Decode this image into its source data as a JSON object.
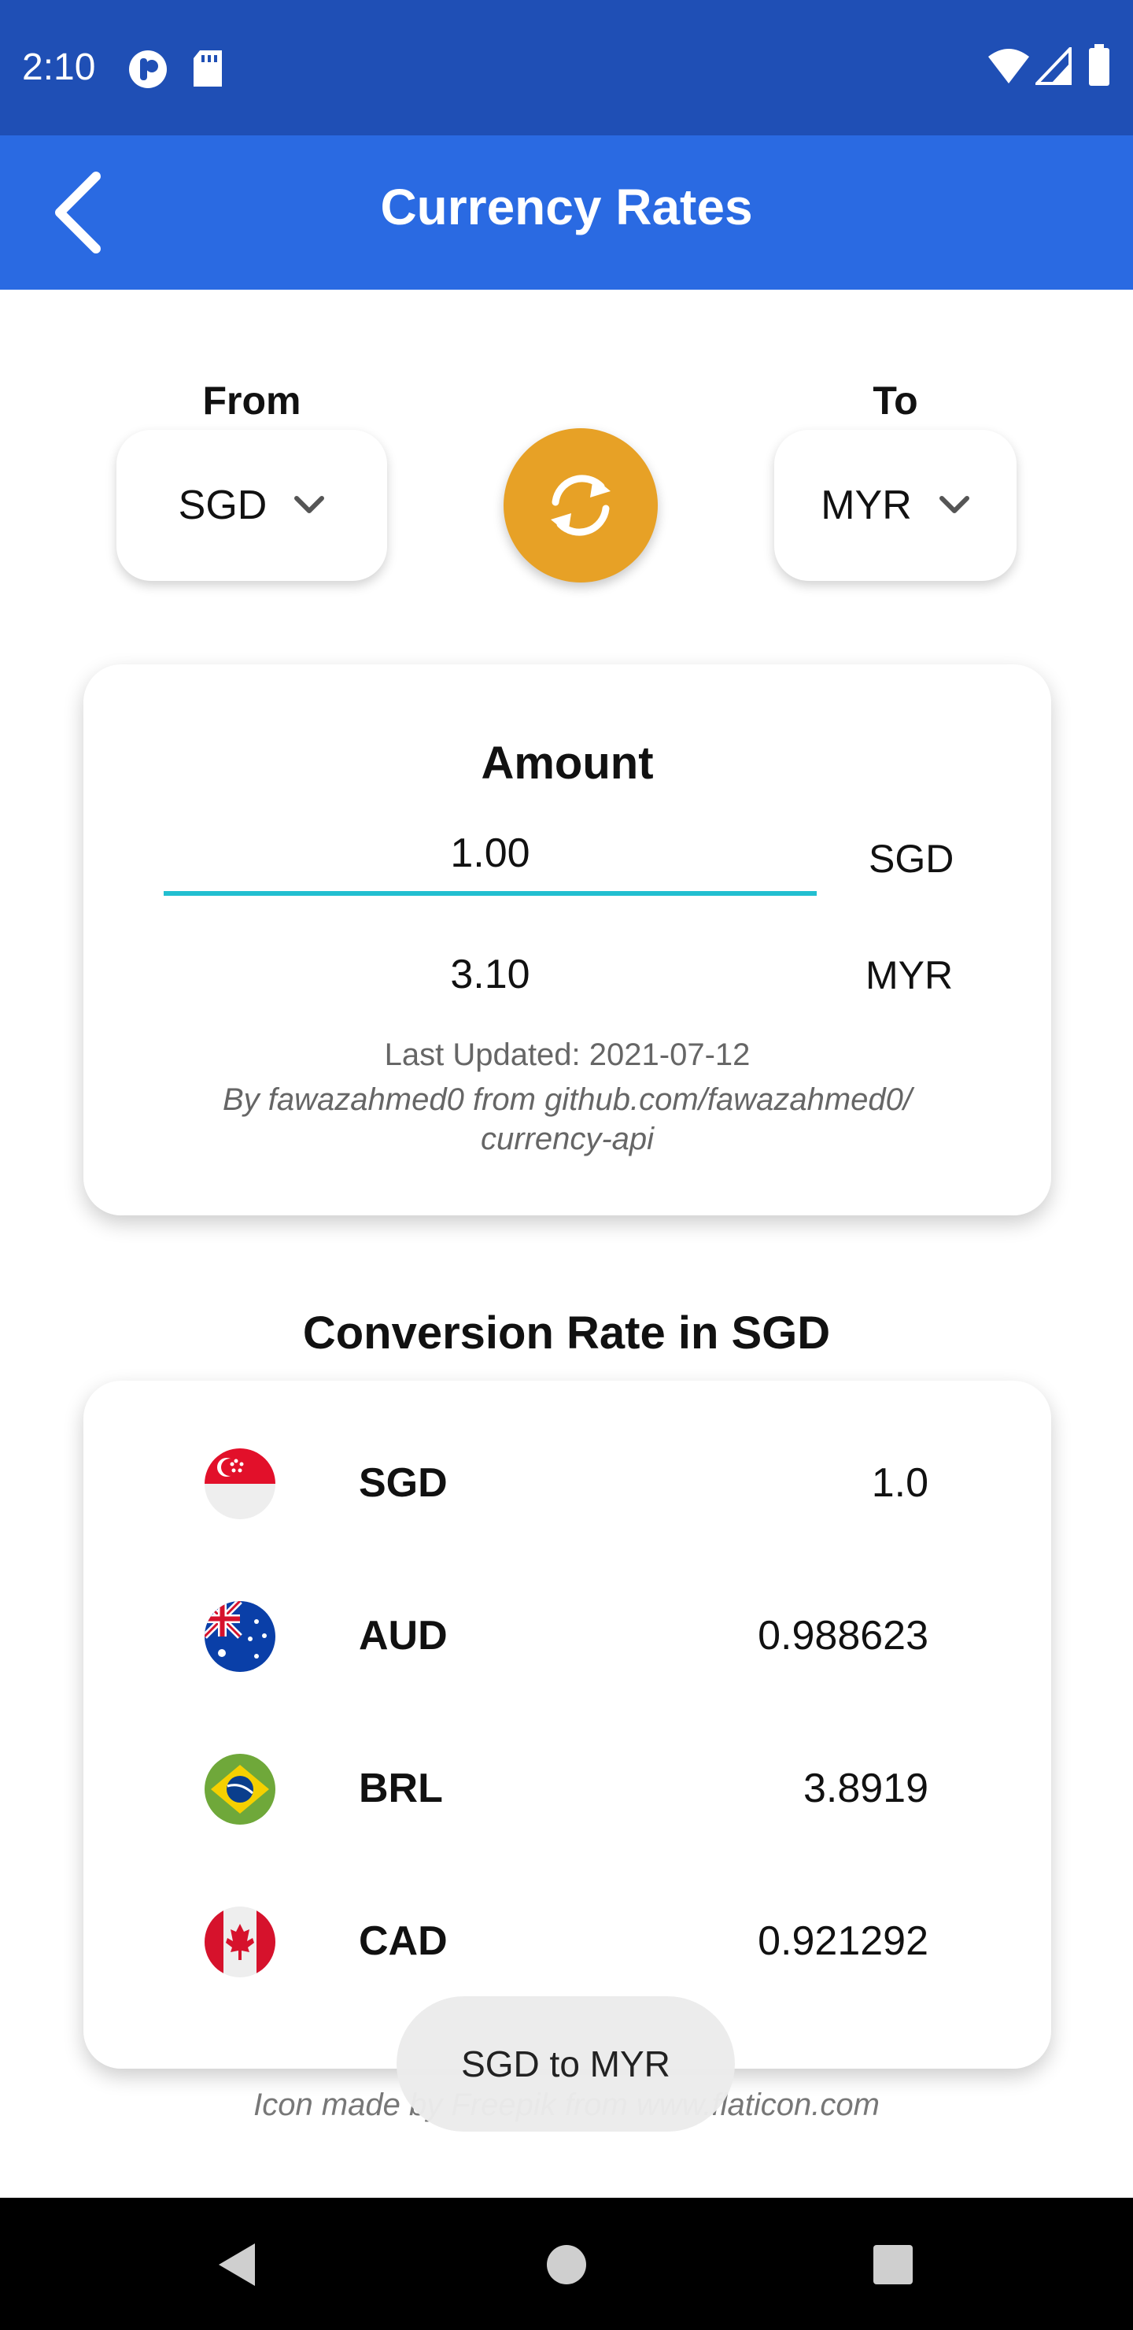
{
  "status_bar": {
    "time": "2:10"
  },
  "app_bar": {
    "title": "Currency Rates"
  },
  "converter": {
    "from_label": "From",
    "to_label": "To",
    "from_currency": "SGD",
    "to_currency": "MYR"
  },
  "amount_card": {
    "title": "Amount",
    "input_value": "1.00",
    "input_currency": "SGD",
    "result_value": "3.10",
    "result_currency": "MYR",
    "last_updated": "Last Updated: 2021-07-12",
    "credit": "By fawazahmed0 from github.com/fawazahmed0/ currency-api"
  },
  "conversion": {
    "title": "Conversion Rate in SGD",
    "rows": [
      {
        "code": "SGD",
        "value": "1.0"
      },
      {
        "code": "AUD",
        "value": "0.988623"
      },
      {
        "code": "BRL",
        "value": "3.8919"
      },
      {
        "code": "CAD",
        "value": "0.921292"
      }
    ]
  },
  "footer": {
    "credit": "Icon made by Freepik from www.flaticon.com"
  },
  "toast": {
    "text": "SGD to MYR"
  },
  "colors": {
    "status_bar": "#1f4fb5",
    "app_bar": "#2a6ae2",
    "swap_button": "#e7a126",
    "input_underline": "#22bfd0"
  }
}
